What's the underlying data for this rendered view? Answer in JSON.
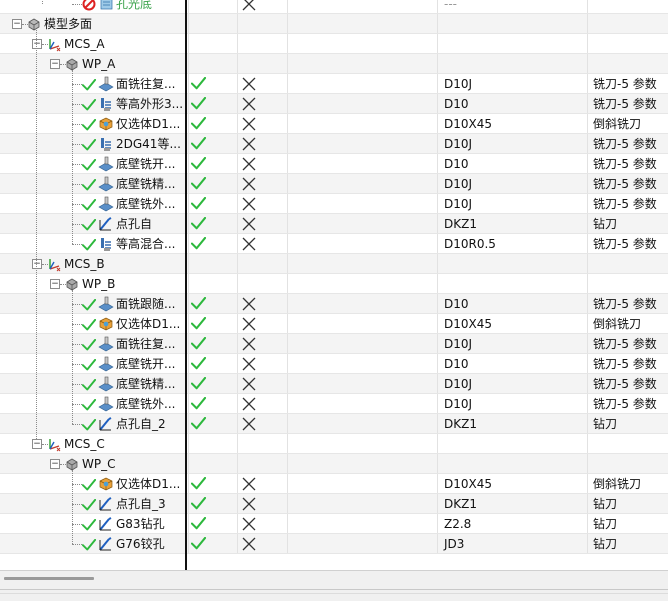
{
  "rows": [
    {
      "level": 4,
      "kind": "noop",
      "name": "孔光底",
      "check": false,
      "cross": true,
      "tool": "---",
      "tooltype": "",
      "green": true
    },
    {
      "level": 1,
      "kind": "geom",
      "name": "模型多面",
      "expander": "−"
    },
    {
      "level": 2,
      "kind": "mcs",
      "name": "MCS_A",
      "expander": "−"
    },
    {
      "level": 3,
      "kind": "wp",
      "name": "WP_A",
      "expander": "−"
    },
    {
      "level": 4,
      "kind": "face",
      "name": "面铣往复...",
      "check": true,
      "cross": true,
      "tool": "D10J",
      "tooltype": "铣刀-5 参数"
    },
    {
      "level": 4,
      "kind": "zlevel",
      "name": "等高外形3...",
      "check": true,
      "cross": true,
      "tool": "D10",
      "tooltype": "铣刀-5 参数"
    },
    {
      "level": 4,
      "kind": "solid",
      "name": "仅选体D1...",
      "check": true,
      "cross": true,
      "tool": "D10X45",
      "tooltype": "倒斜铣刀"
    },
    {
      "level": 4,
      "kind": "zlevel",
      "name": "2DG41等...",
      "check": true,
      "cross": true,
      "tool": "D10J",
      "tooltype": "铣刀-5 参数"
    },
    {
      "level": 4,
      "kind": "face",
      "name": "底壁铣开...",
      "check": true,
      "cross": true,
      "tool": "D10",
      "tooltype": "铣刀-5 参数"
    },
    {
      "level": 4,
      "kind": "face",
      "name": "底壁铣精...",
      "check": true,
      "cross": true,
      "tool": "D10J",
      "tooltype": "铣刀-5 参数"
    },
    {
      "level": 4,
      "kind": "face",
      "name": "底壁铣外...",
      "check": true,
      "cross": true,
      "tool": "D10J",
      "tooltype": "铣刀-5 参数"
    },
    {
      "level": 4,
      "kind": "drill",
      "name": "点孔自",
      "check": true,
      "cross": true,
      "tool": "DKZ1",
      "tooltype": "钻刀"
    },
    {
      "level": 4,
      "kind": "zlevel",
      "name": "等高混合...",
      "check": true,
      "cross": true,
      "tool": "D10R0.5",
      "tooltype": "铣刀-5 参数"
    },
    {
      "level": 2,
      "kind": "mcs",
      "name": "MCS_B",
      "expander": "−"
    },
    {
      "level": 3,
      "kind": "wp",
      "name": "WP_B",
      "expander": "−"
    },
    {
      "level": 4,
      "kind": "face",
      "name": "面铣跟随...",
      "check": true,
      "cross": true,
      "tool": "D10",
      "tooltype": "铣刀-5 参数"
    },
    {
      "level": 4,
      "kind": "solid",
      "name": "仅选体D1...",
      "check": true,
      "cross": true,
      "tool": "D10X45",
      "tooltype": "倒斜铣刀"
    },
    {
      "level": 4,
      "kind": "face",
      "name": "面铣往复...",
      "check": true,
      "cross": true,
      "tool": "D10J",
      "tooltype": "铣刀-5 参数"
    },
    {
      "level": 4,
      "kind": "face",
      "name": "底壁铣开...",
      "check": true,
      "cross": true,
      "tool": "D10",
      "tooltype": "铣刀-5 参数"
    },
    {
      "level": 4,
      "kind": "face",
      "name": "底壁铣精...",
      "check": true,
      "cross": true,
      "tool": "D10J",
      "tooltype": "铣刀-5 参数"
    },
    {
      "level": 4,
      "kind": "face",
      "name": "底壁铣外...",
      "check": true,
      "cross": true,
      "tool": "D10J",
      "tooltype": "铣刀-5 参数"
    },
    {
      "level": 4,
      "kind": "drill",
      "name": "点孔自_2",
      "check": true,
      "cross": true,
      "tool": "DKZ1",
      "tooltype": "钻刀"
    },
    {
      "level": 2,
      "kind": "mcs",
      "name": "MCS_C",
      "expander": "−"
    },
    {
      "level": 3,
      "kind": "wp",
      "name": "WP_C",
      "expander": "−"
    },
    {
      "level": 4,
      "kind": "solid",
      "name": "仅选体D1...",
      "check": true,
      "cross": true,
      "tool": "D10X45",
      "tooltype": "倒斜铣刀"
    },
    {
      "level": 4,
      "kind": "drill",
      "name": "点孔自_3",
      "check": true,
      "cross": true,
      "tool": "DKZ1",
      "tooltype": "钻刀"
    },
    {
      "level": 4,
      "kind": "drill",
      "name": "G83钻孔",
      "check": true,
      "cross": true,
      "tool": "Z2.8",
      "tooltype": "钻刀"
    },
    {
      "level": 4,
      "kind": "drill",
      "name": "G76铰孔",
      "check": true,
      "cross": true,
      "tool": "JD3",
      "tooltype": "钻刀"
    }
  ],
  "colors": {
    "check": "#2db83d",
    "cross": "#333333",
    "accent": "#3aa24a"
  }
}
